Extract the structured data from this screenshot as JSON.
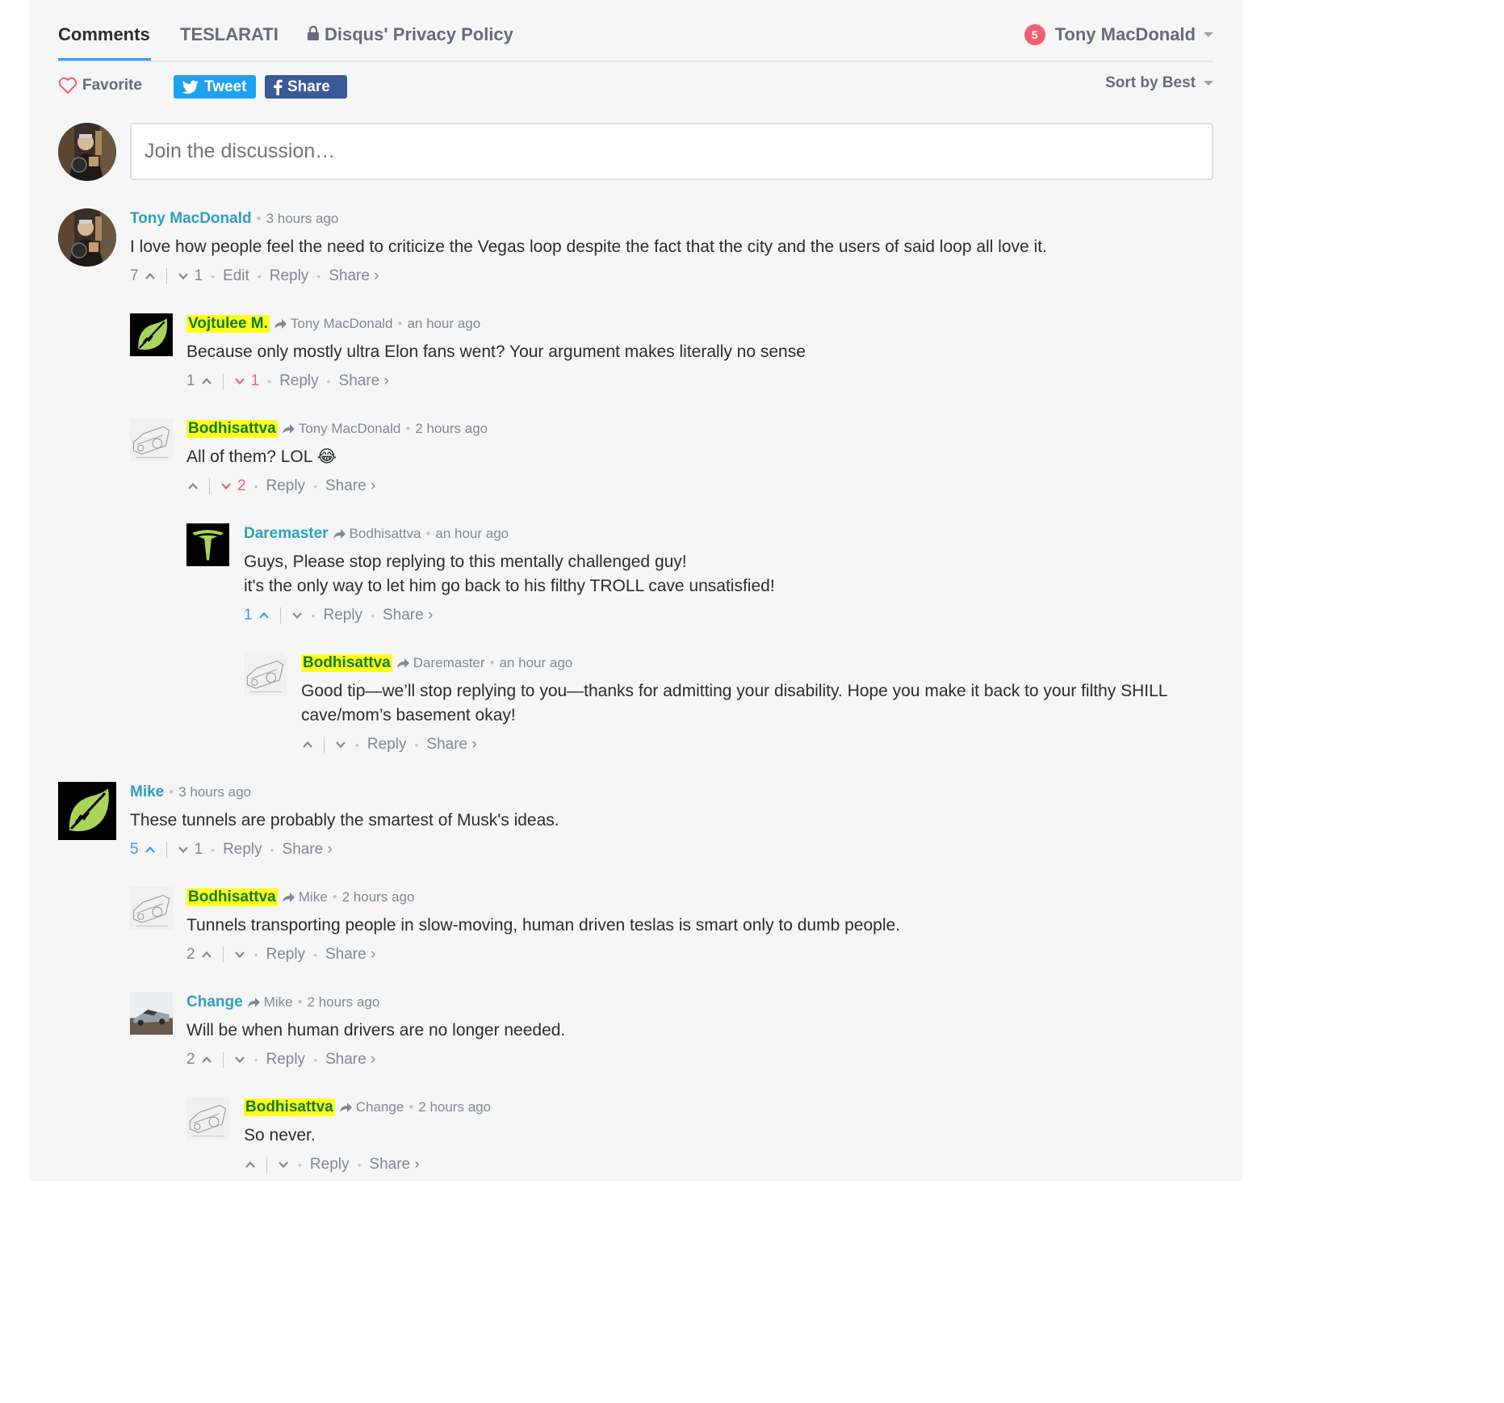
{
  "tabs": {
    "comments": "Comments",
    "site": "TESLARATI",
    "privacy": "Disqus' Privacy Policy"
  },
  "user": {
    "notifications": "5",
    "name": "Tony MacDonald"
  },
  "actions": {
    "favorite": "Favorite",
    "tweet": "Tweet",
    "share": "Share",
    "sort": "Sort by Best"
  },
  "composer": {
    "placeholder": "Join the discussion…"
  },
  "footer_labels": {
    "edit": "Edit",
    "reply": "Reply",
    "share": "Share ›"
  },
  "colors": {
    "accent": "#2e9fff",
    "author": "#2e9fbf",
    "highlight": "#ffff1a",
    "downvote": "#f05f70"
  },
  "comments": [
    {
      "author": "Tony MacDonald",
      "time": "3 hours ago",
      "text": "I love how people feel the need to criticize the Vegas loop despite the fact that the city and the users of said loop all love it.",
      "up": "7",
      "down": "1",
      "avatar": "photo-person"
    },
    {
      "author": "Vojtulee M.",
      "reply_to": "Tony MacDonald",
      "time": "an hour ago",
      "text": "Because only mostly ultra Elon fans went? Your argument makes literally no sense",
      "up": "1",
      "down": "1",
      "avatar": "green-leaf"
    },
    {
      "author": "Bodhisattva",
      "reply_to": "Tony MacDonald",
      "time": "2 hours ago",
      "text": "All of them? LOL 😂",
      "up": "",
      "down": "2",
      "avatar": "sketch-car"
    },
    {
      "author": "Daremaster",
      "reply_to": "Bodhisattva",
      "time": "an hour ago",
      "text": "Guys, Please stop replying to this mentally challenged guy!",
      "text2": "it's the only way to let him go back to his filthy TROLL cave unsatisfied!",
      "up": "1",
      "down": "",
      "avatar": "tesla-logo"
    },
    {
      "author": "Bodhisattva",
      "reply_to": "Daremaster",
      "time": "an hour ago",
      "text": "Good tip—we’ll stop replying to you—thanks for admitting your disability. Hope you make it back to your filthy SHILL",
      "text2": "cave/mom’s basement okay!",
      "up": "",
      "down": "",
      "avatar": "sketch-car"
    },
    {
      "author": "Mike",
      "time": "3 hours ago",
      "text": "These tunnels are probably the smartest of Musk's ideas.",
      "up": "5",
      "down": "1",
      "avatar": "green-leaf"
    },
    {
      "author": "Bodhisattva",
      "reply_to": "Mike",
      "time": "2 hours ago",
      "text": "Tunnels transporting people in slow-moving, human driven teslas is smart only to dumb people.",
      "up": "2",
      "down": "",
      "avatar": "sketch-car"
    },
    {
      "author": "Change",
      "reply_to": "Mike",
      "time": "2 hours ago",
      "text": "Will be when human drivers are no longer needed.",
      "up": "2",
      "down": "",
      "avatar": "cybertruck-photo"
    },
    {
      "author": "Bodhisattva",
      "reply_to": "Change",
      "time": "2 hours ago",
      "text": "So never.",
      "up": "",
      "down": "",
      "avatar": "sketch-car"
    }
  ]
}
